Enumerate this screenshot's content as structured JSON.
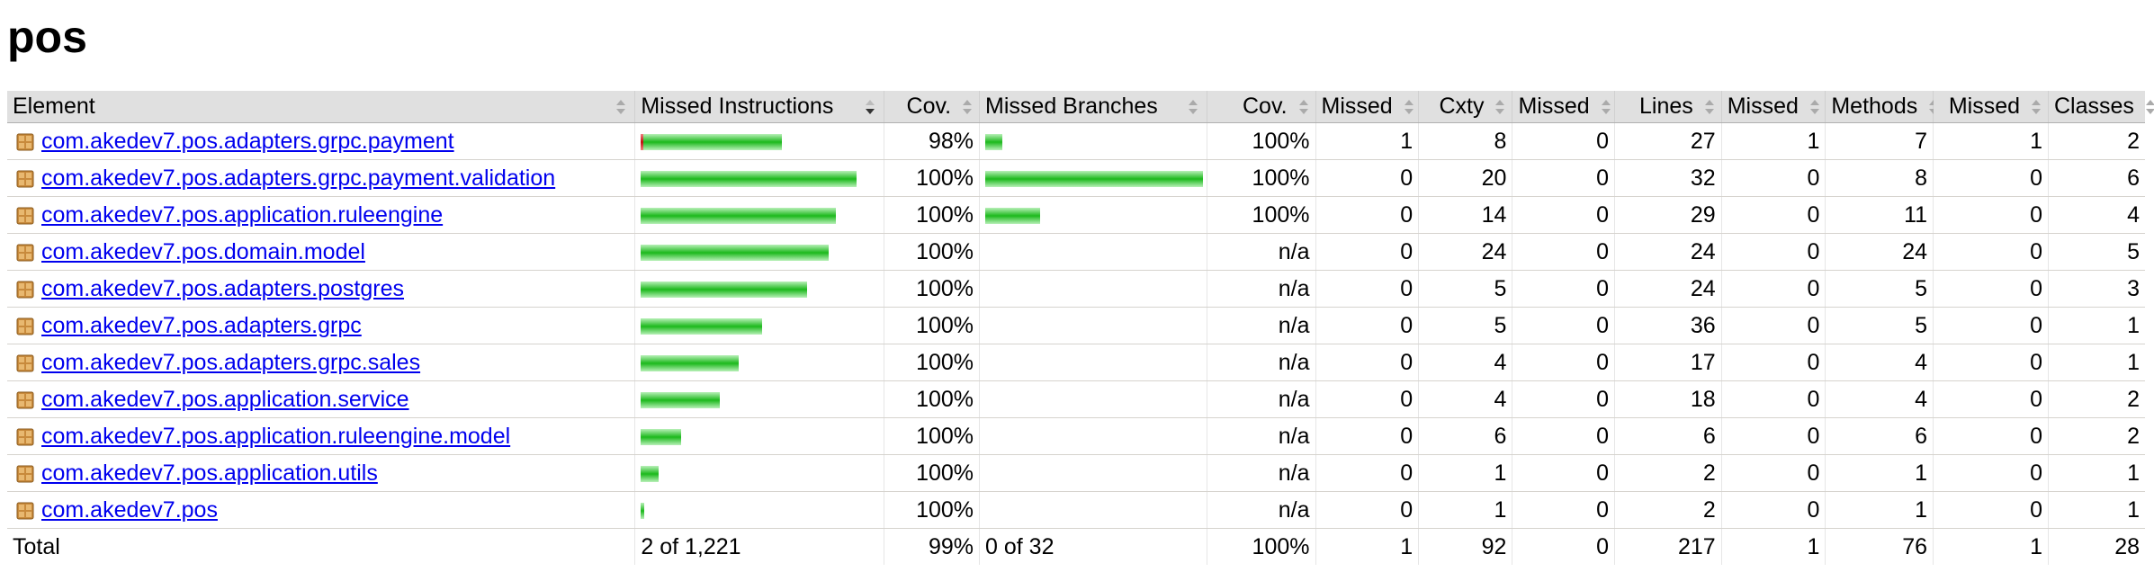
{
  "page": {
    "title": "pos"
  },
  "colors": {
    "header_bg": "#e0e0e0",
    "link": "#0000ee",
    "bar_green": "#1cb91c",
    "bar_red": "#c01010",
    "package_icon": "#c88a3c"
  },
  "table": {
    "headers": {
      "element": "Element",
      "missed_instructions": "Missed Instructions",
      "instr_cov": "Cov.",
      "missed_branches": "Missed Branches",
      "branch_cov": "Cov.",
      "missed_cxty": "Missed",
      "cxty": "Cxty",
      "missed_lines": "Missed",
      "lines": "Lines",
      "missed_methods": "Missed",
      "methods": "Methods",
      "missed_classes": "Missed",
      "classes": "Classes"
    },
    "icons": {
      "sort": "sort-icon",
      "sort_active": "sort-descending-icon",
      "package": "package-icon"
    },
    "rows": [
      {
        "element": "com.akedev7.pos.adapters.grpc.payment",
        "instr_missed_frac": 0.02,
        "instr_bar_fraction": 0.654,
        "instr_cov": "98%",
        "branch_missed_frac": 0.0,
        "branch_bar_fraction": 0.08,
        "branch_cov": "100%",
        "missed_cxty": "1",
        "cxty": "8",
        "missed_lines": "0",
        "lines": "27",
        "missed_methods": "1",
        "methods": "7",
        "missed_classes": "1",
        "classes": "2"
      },
      {
        "element": "com.akedev7.pos.adapters.grpc.payment.validation",
        "instr_missed_frac": 0.0,
        "instr_bar_fraction": 1.0,
        "instr_cov": "100%",
        "branch_missed_frac": 0.0,
        "branch_bar_fraction": 1.0,
        "branch_cov": "100%",
        "missed_cxty": "0",
        "cxty": "20",
        "missed_lines": "0",
        "lines": "32",
        "missed_methods": "0",
        "methods": "8",
        "missed_classes": "0",
        "classes": "6"
      },
      {
        "element": "com.akedev7.pos.application.ruleengine",
        "instr_missed_frac": 0.0,
        "instr_bar_fraction": 0.904,
        "instr_cov": "100%",
        "branch_missed_frac": 0.0,
        "branch_bar_fraction": 0.25,
        "branch_cov": "100%",
        "missed_cxty": "0",
        "cxty": "14",
        "missed_lines": "0",
        "lines": "29",
        "missed_methods": "0",
        "methods": "11",
        "missed_classes": "0",
        "classes": "4"
      },
      {
        "element": "com.akedev7.pos.domain.model",
        "instr_missed_frac": 0.0,
        "instr_bar_fraction": 0.872,
        "instr_cov": "100%",
        "branch_missed_frac": null,
        "branch_bar_fraction": 0,
        "branch_cov": "n/a",
        "missed_cxty": "0",
        "cxty": "24",
        "missed_lines": "0",
        "lines": "24",
        "missed_methods": "0",
        "methods": "24",
        "missed_classes": "0",
        "classes": "5"
      },
      {
        "element": "com.akedev7.pos.adapters.postgres",
        "instr_missed_frac": 0.0,
        "instr_bar_fraction": 0.769,
        "instr_cov": "100%",
        "branch_missed_frac": null,
        "branch_bar_fraction": 0,
        "branch_cov": "n/a",
        "missed_cxty": "0",
        "cxty": "5",
        "missed_lines": "0",
        "lines": "24",
        "missed_methods": "0",
        "methods": "5",
        "missed_classes": "0",
        "classes": "3"
      },
      {
        "element": "com.akedev7.pos.adapters.grpc",
        "instr_missed_frac": 0.0,
        "instr_bar_fraction": 0.564,
        "instr_cov": "100%",
        "branch_missed_frac": null,
        "branch_bar_fraction": 0,
        "branch_cov": "n/a",
        "missed_cxty": "0",
        "cxty": "5",
        "missed_lines": "0",
        "lines": "36",
        "missed_methods": "0",
        "methods": "5",
        "missed_classes": "0",
        "classes": "1"
      },
      {
        "element": "com.akedev7.pos.adapters.grpc.sales",
        "instr_missed_frac": 0.0,
        "instr_bar_fraction": 0.455,
        "instr_cov": "100%",
        "branch_missed_frac": null,
        "branch_bar_fraction": 0,
        "branch_cov": "n/a",
        "missed_cxty": "0",
        "cxty": "4",
        "missed_lines": "0",
        "lines": "17",
        "missed_methods": "0",
        "methods": "4",
        "missed_classes": "0",
        "classes": "1"
      },
      {
        "element": "com.akedev7.pos.application.service",
        "instr_missed_frac": 0.0,
        "instr_bar_fraction": 0.365,
        "instr_cov": "100%",
        "branch_missed_frac": null,
        "branch_bar_fraction": 0,
        "branch_cov": "n/a",
        "missed_cxty": "0",
        "cxty": "4",
        "missed_lines": "0",
        "lines": "18",
        "missed_methods": "0",
        "methods": "4",
        "missed_classes": "0",
        "classes": "2"
      },
      {
        "element": "com.akedev7.pos.application.ruleengine.model",
        "instr_missed_frac": 0.0,
        "instr_bar_fraction": 0.186,
        "instr_cov": "100%",
        "branch_missed_frac": null,
        "branch_bar_fraction": 0,
        "branch_cov": "n/a",
        "missed_cxty": "0",
        "cxty": "6",
        "missed_lines": "0",
        "lines": "6",
        "missed_methods": "0",
        "methods": "6",
        "missed_classes": "0",
        "classes": "2"
      },
      {
        "element": "com.akedev7.pos.application.utils",
        "instr_missed_frac": 0.0,
        "instr_bar_fraction": 0.083,
        "instr_cov": "100%",
        "branch_missed_frac": null,
        "branch_bar_fraction": 0,
        "branch_cov": "n/a",
        "missed_cxty": "0",
        "cxty": "1",
        "missed_lines": "0",
        "lines": "2",
        "missed_methods": "0",
        "methods": "1",
        "missed_classes": "0",
        "classes": "1"
      },
      {
        "element": "com.akedev7.pos",
        "instr_missed_frac": 0.0,
        "instr_bar_fraction": 0.013,
        "instr_cov": "100%",
        "branch_missed_frac": null,
        "branch_bar_fraction": 0,
        "branch_cov": "n/a",
        "missed_cxty": "0",
        "cxty": "1",
        "missed_lines": "0",
        "lines": "2",
        "missed_methods": "0",
        "methods": "1",
        "missed_classes": "0",
        "classes": "1"
      }
    ],
    "total": {
      "label": "Total",
      "missed_instructions": "2 of 1,221",
      "instr_cov": "99%",
      "missed_branches": "0 of 32",
      "branch_cov": "100%",
      "missed_cxty": "1",
      "cxty": "92",
      "missed_lines": "0",
      "lines": "217",
      "missed_methods": "1",
      "methods": "76",
      "missed_classes": "1",
      "classes": "28"
    }
  }
}
